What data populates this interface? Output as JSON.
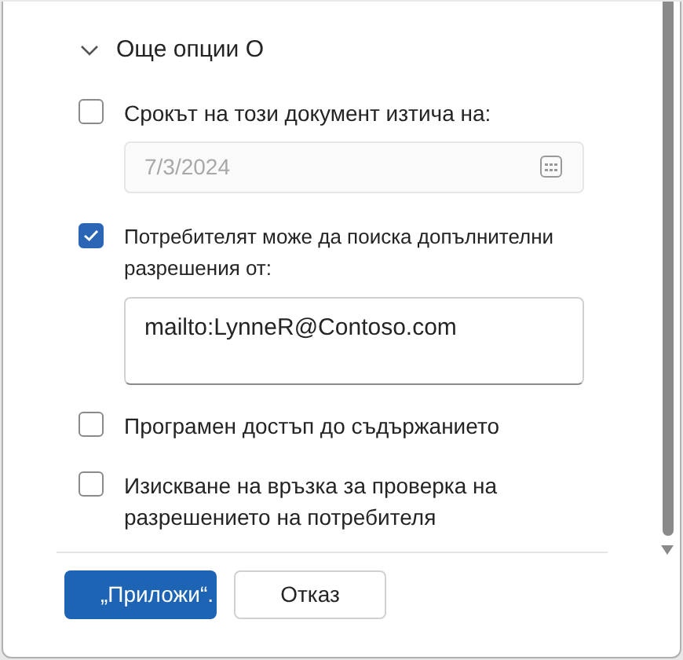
{
  "section": {
    "title": "Още опции О",
    "expanded": true
  },
  "options": [
    {
      "label": "Срокът на този документ изтича на:",
      "checked": false,
      "field": {
        "kind": "date",
        "value": "7/3/2024",
        "disabled": true
      }
    },
    {
      "label": "Потребителят може да поиска допълнителни разрешения от:",
      "checked": true,
      "field": {
        "kind": "text",
        "value": "mailto:LynneR@Contoso.com",
        "disabled": false
      }
    },
    {
      "label": "Програмен достъп до съдържанието",
      "checked": false
    },
    {
      "label": "Изискване на връзка за проверка на разрешението на потребителя",
      "checked": false
    }
  ],
  "buttons": [
    {
      "label": "„Приложи“.",
      "kind": "primary"
    },
    {
      "label": "Отказ",
      "kind": "secondary"
    }
  ]
}
